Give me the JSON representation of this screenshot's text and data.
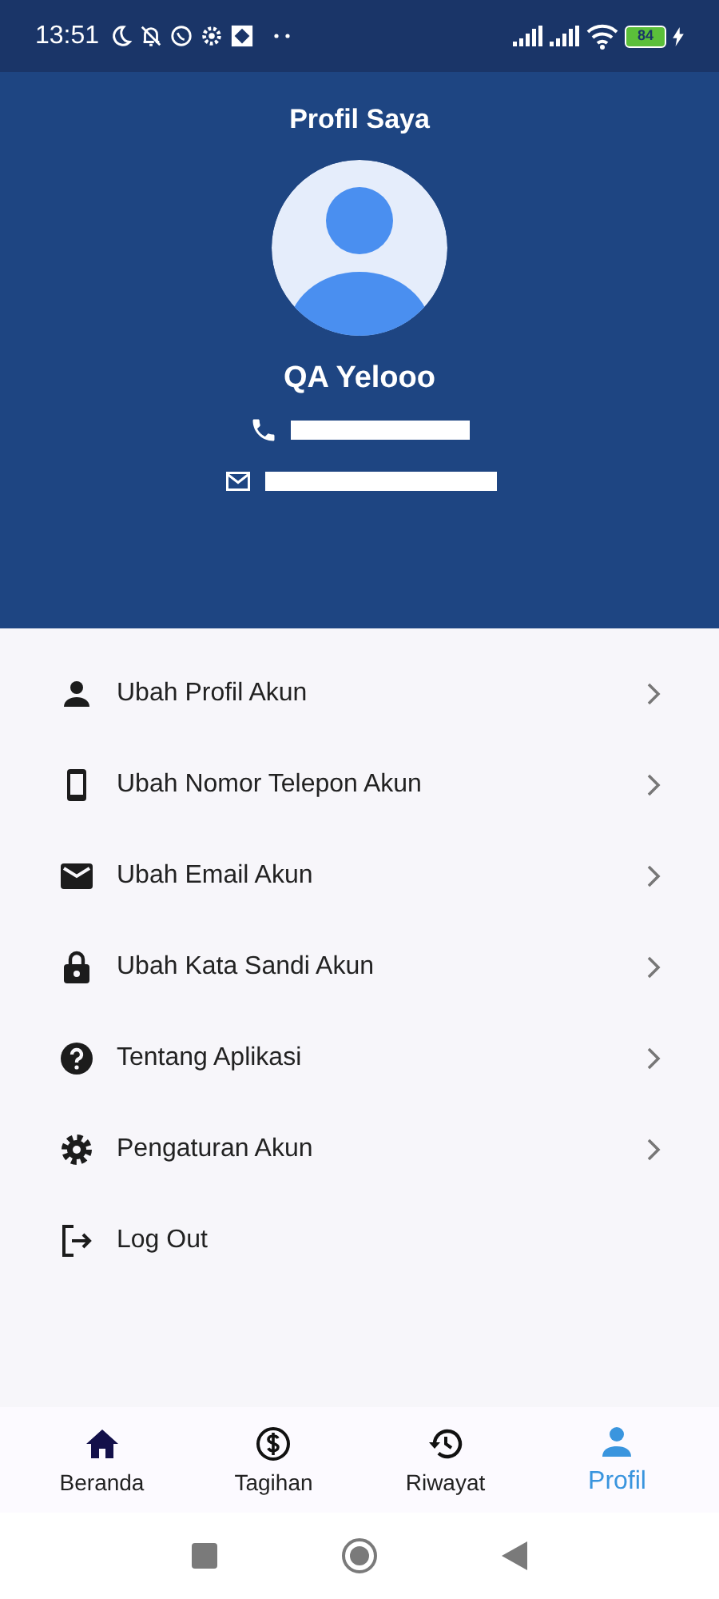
{
  "status_bar": {
    "time": "13:51",
    "battery": "84"
  },
  "header": {
    "title": "Profil Saya",
    "name": "QA Yelooo"
  },
  "menu": [
    {
      "label": "Ubah Profil Akun",
      "chevron": true
    },
    {
      "label": "Ubah Nomor Telepon Akun",
      "chevron": true
    },
    {
      "label": "Ubah Email Akun",
      "chevron": true
    },
    {
      "label": "Ubah Kata Sandi Akun",
      "chevron": true
    },
    {
      "label": "Tentang Aplikasi",
      "chevron": true
    },
    {
      "label": "Pengaturan Akun",
      "chevron": true
    },
    {
      "label": "Log Out",
      "chevron": false
    }
  ],
  "bottom_nav": [
    {
      "label": "Beranda",
      "selected": false
    },
    {
      "label": "Tagihan",
      "selected": false
    },
    {
      "label": "Riwayat",
      "selected": false
    },
    {
      "label": "Profil",
      "selected": true
    }
  ]
}
